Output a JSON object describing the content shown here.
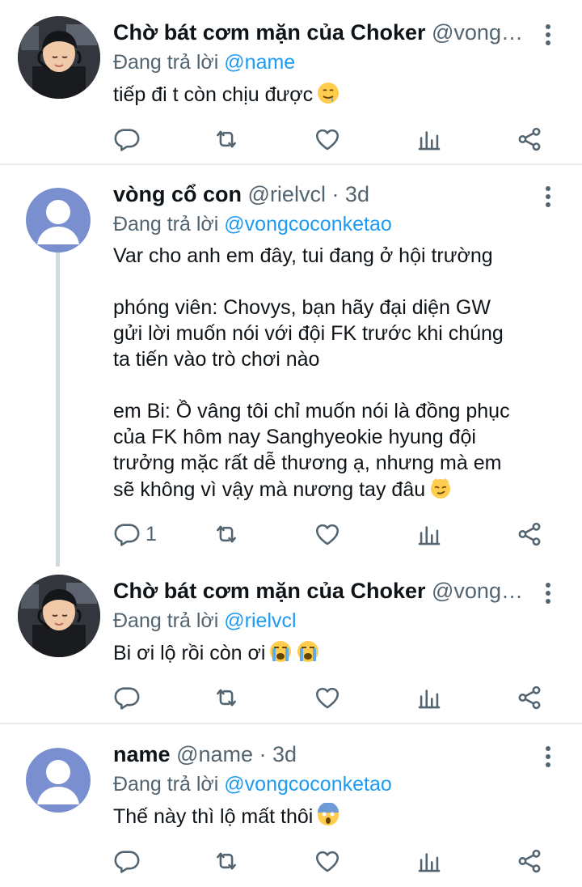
{
  "tweets": [
    {
      "name": "Chờ bát cơm mặn của Choker",
      "meta": "@vongco...",
      "replying_prefix": "Đang trả lời",
      "replying_to": "@name",
      "text": [
        "tiếp đi t còn chịu được"
      ],
      "emoji": "drooling-face",
      "reply_count": ""
    },
    {
      "name": "vòng cổ con",
      "meta": "@rielvcl · 3d",
      "replying_prefix": "Đang trả lời",
      "replying_to": "@vongcoconketao",
      "text": [
        "Var cho anh em đây, tui đang ở hội trường",
        "phóng viên: Chovys, bạn hãy đại diện GW\ngửi lời muốn nói với đội FK trước khi chúng\nta tiến vào trò chơi nào",
        "em Bi: Ồ vâng tôi chỉ muốn nói là đồng phục\ncủa FK hôm nay Sanghyeokie hyung đội\ntrưởng mặc rất dễ thương ạ, nhưng mà em\nsẽ không vì vậy mà nương tay đâu"
      ],
      "emoji": "smirking-cat",
      "reply_count": "1"
    },
    {
      "name": "Chờ bát cơm mặn của Choker",
      "meta": "@vongco...",
      "replying_prefix": "Đang trả lời",
      "replying_to": "@rielvcl",
      "text": [
        "Bi ơi lộ rồi còn ơi"
      ],
      "emoji": "loudly-crying-face-x2",
      "reply_count": ""
    },
    {
      "name": "name",
      "meta": "@name · 3d",
      "replying_prefix": "Đang trả lời",
      "replying_to": "@vongcoconketao",
      "text": [
        "Thế này thì lộ mất thôi"
      ],
      "emoji": "screaming-face",
      "reply_count": ""
    }
  ],
  "colors": {
    "mention": "#1d9bf0",
    "secondary": "#536471",
    "divider": "#e6ecf0",
    "thread_line": "#cfd9de"
  }
}
